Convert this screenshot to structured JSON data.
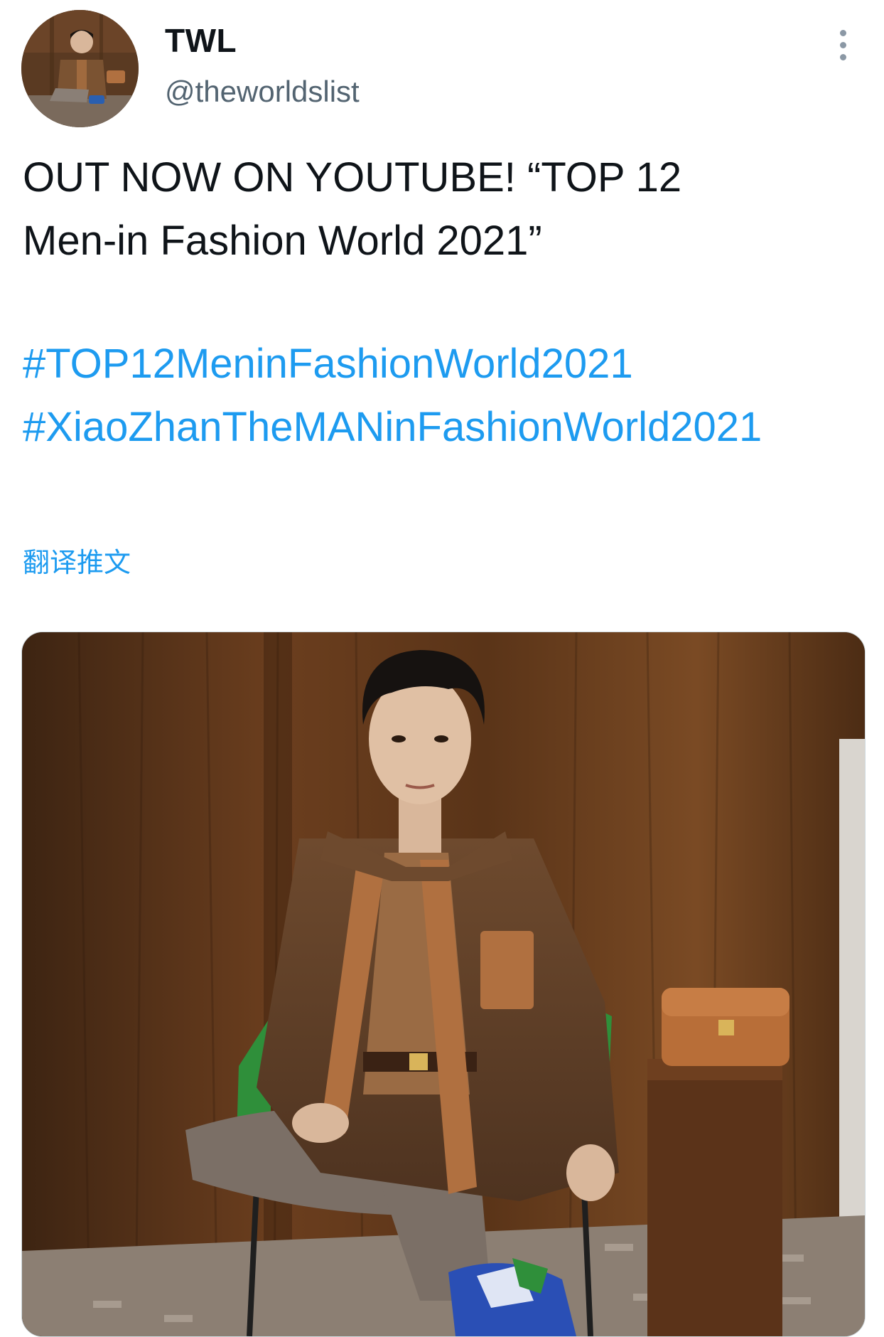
{
  "user": {
    "display_name": "TWL",
    "handle": "@theworldslist"
  },
  "tweet": {
    "text_line1": "OUT NOW ON YOUTUBE! “TOP 12",
    "text_line2": "Men-in Fashion World 2021”",
    "hashtags": [
      "#TOP12MeninFashionWorld2021",
      "#XiaoZhanTheMANinFashionWorld2021"
    ],
    "translate_label": "翻译推文"
  },
  "icons": {
    "more": "more-options-icon"
  },
  "colors": {
    "link": "#1d9bf0",
    "text": "#0f1419",
    "secondary": "#536471"
  }
}
